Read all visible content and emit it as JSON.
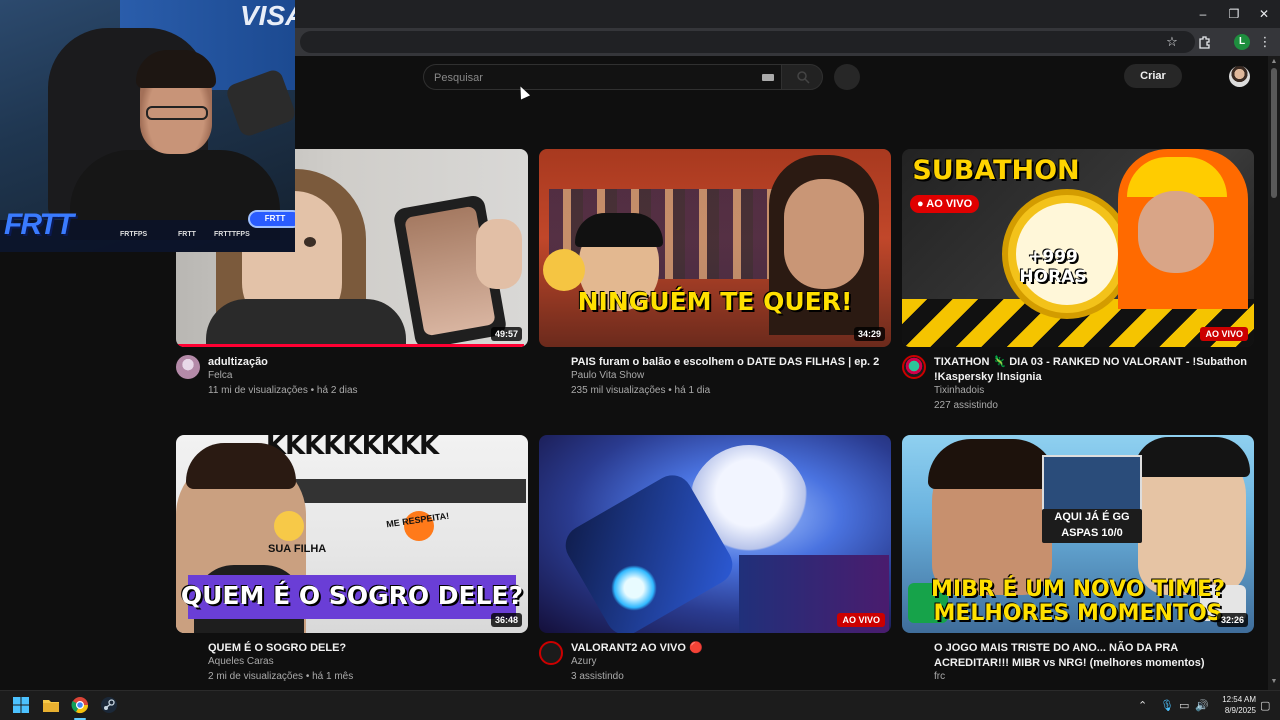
{
  "browser": {
    "minimize": "–",
    "maximize": "❐",
    "close": "✕",
    "profile_initial": "L"
  },
  "header": {
    "search_placeholder": "Pesquisar",
    "create_label": "Criar"
  },
  "videos": [
    {
      "title": "adultização",
      "channel": "Felca",
      "stats": "11 mi de visualizações • há 2 dias",
      "duration": "49:57",
      "watched_fraction": 0.99
    },
    {
      "title": "PAIS furam o balão e escolhem o DATE DAS FILHAS | ep. 2",
      "channel": "Paulo Vita Show",
      "stats": "235 mil visualizações • há 1 dia",
      "duration": "34:29",
      "thumb_text": "NINGUÉM TE QUER!"
    },
    {
      "title": "TIXATHON 🦎 DIA 03 - RANKED NO VALORANT - !Subathon !Kaspersky !Insignia",
      "channel": "Tixinhadois",
      "stats": "227 assistindo",
      "badge": "AO VIVO",
      "thumb_text": "SUBATHON",
      "thumb_live": "● AO VIVO",
      "thumb_hours": "+999 HORAS"
    },
    {
      "title": "QUEM É O SOGRO DELE?",
      "channel": "Aqueles Caras",
      "stats": "2 mi de visualizações • há 1 mês",
      "duration": "36:48",
      "thumb_text": "QUEM É O SOGRO DELE?",
      "thumb_top": "KKKKKKKKK",
      "thumb_label1": "SUA FILHA",
      "thumb_label2": "ME RESPEITA!"
    },
    {
      "title": "VALORANT2  AO VIVO 🔴",
      "channel": "Azury",
      "stats": "3 assistindo",
      "badge": "AO VIVO"
    },
    {
      "title": "O JOGO MAIS TRISTE DO ANO... NÃO DA PRA ACREDITAR!!! MIBR vs NRG! (melhores momentos)",
      "channel": "frc",
      "stats": "",
      "duration": "32:26",
      "thumb_text1": "MIBR É UM NOVO TIME?",
      "thumb_text2": "MELHORES MOMENTOS",
      "thumb_tag": "AQUI JÁ É GG ASPAS 10/0"
    }
  ],
  "webcam": {
    "banner": "VISA",
    "logo": "FRTT",
    "handles": [
      "FRTFPS",
      "FRTT",
      "FRTTTFPS"
    ],
    "tag": "FRTT"
  },
  "taskbar": {
    "time": "12:54 AM",
    "date": "8/9/2025"
  },
  "colors": {
    "background": "#0f0f0f",
    "live_red": "#cc0000",
    "progress_red": "#ff0033"
  }
}
